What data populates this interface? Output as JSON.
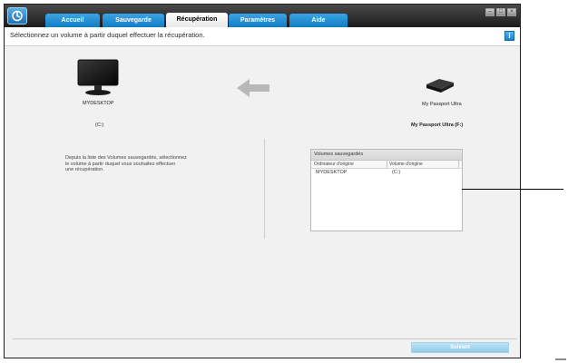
{
  "tabs": [
    {
      "label": "Accueil",
      "active": false
    },
    {
      "label": "Sauvegarde",
      "active": false
    },
    {
      "label": "Récupération",
      "active": true
    },
    {
      "label": "Paramètres",
      "active": false
    },
    {
      "label": "Aide",
      "active": false
    }
  ],
  "subbar": {
    "text": "Sélectionnez un volume à partir duquel effectuer la récupération."
  },
  "source": {
    "name": "MYDESKTOP",
    "drive": "(C:)"
  },
  "target": {
    "name": "My Passport Ultra",
    "drive": "My Passport Ultra (F:)"
  },
  "instructions": "Depuis la liste des Volumes sauvegardés, sélectionnez\nle volume à partir duquel vous souhaitez effectuer\nune récupération.",
  "volumes": {
    "title": "Volumes sauvegardés",
    "columns": [
      "Ordinateur d'origine",
      "Volume d'origine"
    ],
    "rows": [
      {
        "computer": "MYDESKTOP",
        "volume": "(C:)"
      }
    ]
  },
  "next_label": "Suivant",
  "icons": {
    "app": "wd-logo-icon",
    "help": "info-icon",
    "monitor": "monitor-icon",
    "drive": "external-drive-icon",
    "arrow": "arrow-left-icon"
  },
  "colors": {
    "tab": "#1f8ad4",
    "accent": "#3aa3e6",
    "titlebar": "#2a2a2a"
  }
}
